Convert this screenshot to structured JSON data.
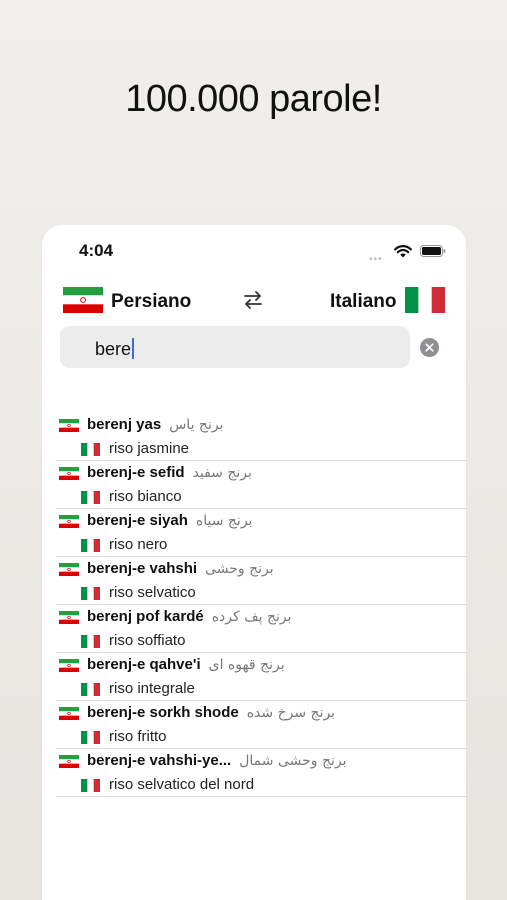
{
  "headline": "100.000 parole!",
  "status_bar": {
    "time": "4:04"
  },
  "languages": {
    "source": "Persiano",
    "target": "Italiano",
    "source_flag_icon": "flag-iran-icon",
    "target_flag_icon": "flag-italy-icon"
  },
  "search": {
    "value": "bere"
  },
  "results": [
    {
      "term": "berenj yas",
      "native": "برنج یاس",
      "translation": "riso jasmine"
    },
    {
      "term": "berenj-e sefid",
      "native": "برنج سفید",
      "translation": "riso bianco"
    },
    {
      "term": "berenj-e siyah",
      "native": "برنج سیاه",
      "translation": "riso nero"
    },
    {
      "term": "berenj-e vahshi",
      "native": "برنج وحشی",
      "translation": "riso selvatico"
    },
    {
      "term": "berenj pof kardé",
      "native": "برنج پف کرده",
      "translation": "riso soffiato"
    },
    {
      "term": "berenj-e qahve'i",
      "native": "برنج قهوه ای",
      "translation": "riso integrale"
    },
    {
      "term": "berenj-e sorkh shode",
      "native": "برنج سرخ شده",
      "translation": "riso fritto"
    },
    {
      "term": "berenj-e vahshi-ye...",
      "native": "برنج وحشی شمال",
      "translation": "riso selvatico del nord"
    }
  ],
  "colors": {
    "iran_green": "#239f40",
    "iran_red": "#da0000",
    "italy_green": "#009246",
    "italy_red": "#ce2b37",
    "accent": "#2f6fe0"
  }
}
